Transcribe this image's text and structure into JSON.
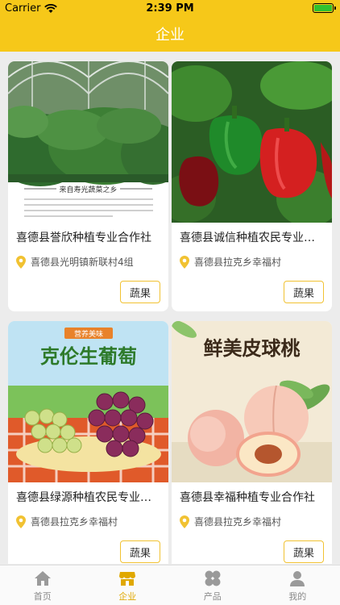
{
  "status": {
    "carrier": "Carrier",
    "time": "2:39 PM"
  },
  "header": {
    "title": "企业"
  },
  "cards": [
    {
      "name": "喜德县誉欣种植专业合作社",
      "address": "喜德县光明镇新联村4组",
      "tag": "蔬果",
      "image_caption": "来自寿光蔬菜之乡"
    },
    {
      "name": "喜德县诚信种植农民专业…",
      "address": "喜德县拉克乡幸福村",
      "tag": "蔬果"
    },
    {
      "name": "喜德县绿源种植农民专业…",
      "address": "喜德县拉克乡幸福村",
      "tag": "蔬果",
      "image_banner": "营养美味",
      "image_title": "克伦生葡萄"
    },
    {
      "name": "喜德县幸福种植专业合作社",
      "address": "喜德县拉克乡幸福村",
      "tag": "蔬果",
      "image_title": "鲜美皮球桃"
    }
  ],
  "tabbar": {
    "items": [
      {
        "label": "首页",
        "icon": "home-icon"
      },
      {
        "label": "企业",
        "icon": "store-icon",
        "active": true
      },
      {
        "label": "产品",
        "icon": "grid-icon"
      },
      {
        "label": "我的",
        "icon": "user-icon"
      }
    ]
  },
  "colors": {
    "accent": "#f6c819",
    "active_tab": "#e0a800",
    "tag_border": "#f1c232"
  }
}
